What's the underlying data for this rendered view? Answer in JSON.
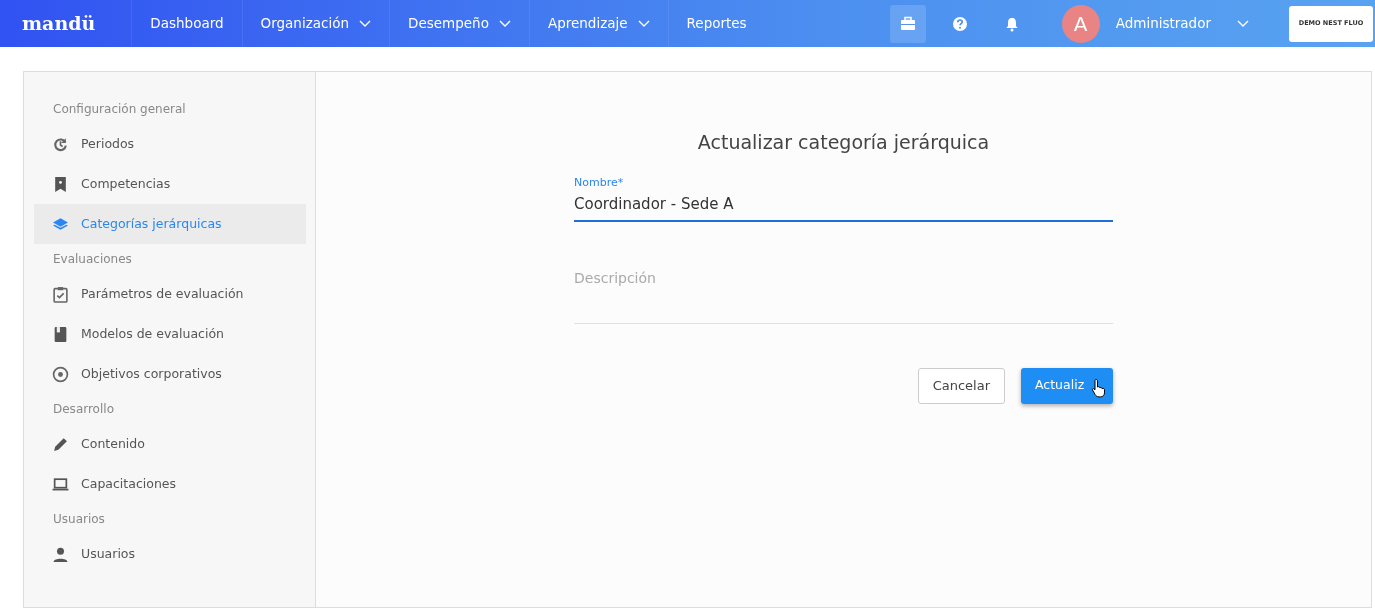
{
  "navbar": {
    "logo": "mandü",
    "items": [
      {
        "label": "Dashboard",
        "dropdown": false
      },
      {
        "label": "Organización",
        "dropdown": true
      },
      {
        "label": "Desempeño",
        "dropdown": true
      },
      {
        "label": "Aprendizaje",
        "dropdown": true
      },
      {
        "label": "Reportes",
        "dropdown": false
      }
    ],
    "tools": [
      {
        "kind": "briefcase",
        "selected": true
      },
      {
        "kind": "help",
        "selected": false
      },
      {
        "kind": "bell",
        "selected": false
      }
    ],
    "user": {
      "avatar": "A",
      "name": "Administrador"
    },
    "company": "DEMO NEST FLUO"
  },
  "sidebar": {
    "sections": [
      {
        "title": "Configuración general",
        "items": [
          {
            "label": "Periodos",
            "kind": "history",
            "selected": false
          },
          {
            "label": "Competencias",
            "kind": "bookmark",
            "selected": false
          },
          {
            "label": "Categorías jerárquicas",
            "kind": "layers",
            "selected": true
          }
        ]
      },
      {
        "title": "Evaluaciones",
        "items": [
          {
            "label": "Parámetros de evaluación",
            "kind": "clipboard",
            "selected": false
          },
          {
            "label": "Modelos de evaluación",
            "kind": "book",
            "selected": false
          },
          {
            "label": "Objetivos corporativos",
            "kind": "target",
            "selected": false
          }
        ]
      },
      {
        "title": "Desarrollo",
        "items": [
          {
            "label": "Contenido",
            "kind": "pencil",
            "selected": false
          },
          {
            "label": "Capacitaciones",
            "kind": "laptop",
            "selected": false
          }
        ]
      },
      {
        "title": "Usuarios",
        "items": [
          {
            "label": "Usuarios",
            "kind": "person",
            "selected": false
          }
        ]
      }
    ]
  },
  "form": {
    "title": "Actualizar categoría jerárquica",
    "fields": [
      {
        "label": "Nombre*",
        "value": "Coordinador - Sede A",
        "focused": true
      },
      {
        "placeholder": "Descripción",
        "focused": false
      }
    ],
    "buttons": [
      {
        "label": "Cancelar",
        "kind": "secondary"
      },
      {
        "label": "Actualiz",
        "kind": "primary"
      }
    ]
  }
}
